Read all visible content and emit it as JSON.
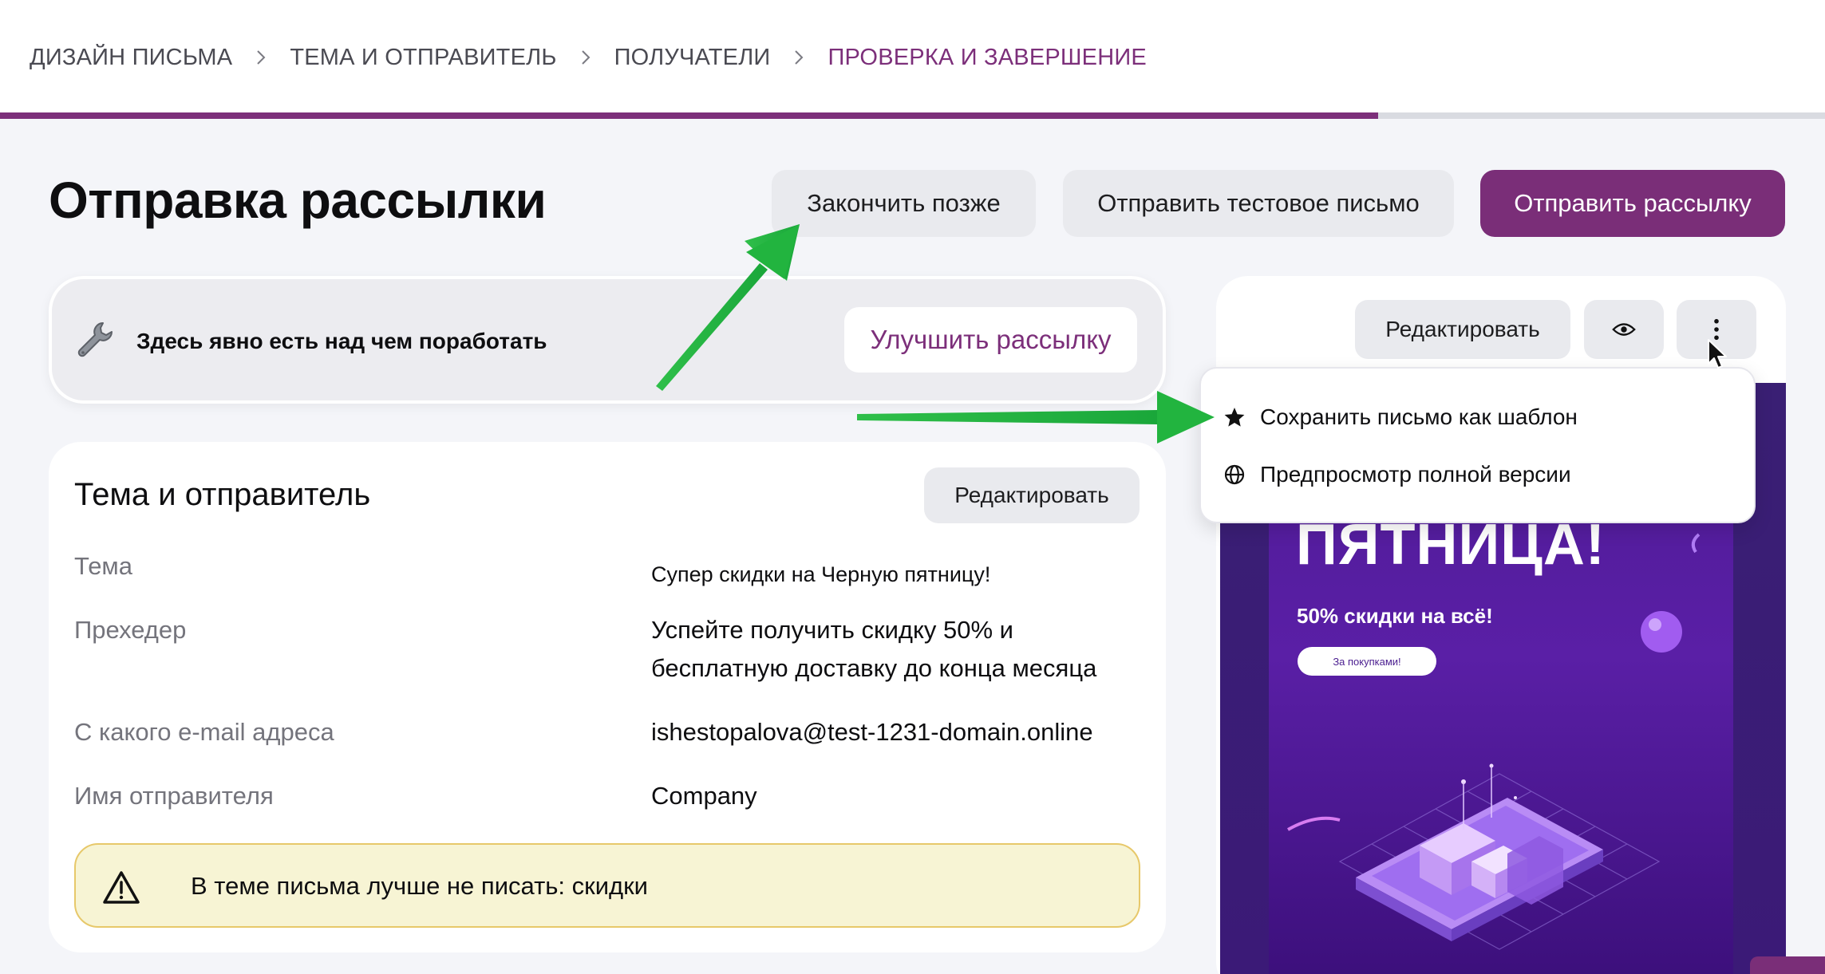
{
  "breadcrumbs": [
    {
      "label": "ДИЗАЙН ПИСЬМА",
      "active": false
    },
    {
      "label": "ТЕМА И ОТПРАВИТЕЛЬ",
      "active": false
    },
    {
      "label": "ПОЛУЧАТЕЛИ",
      "active": false
    },
    {
      "label": "ПРОВЕРКА И ЗАВЕРШЕНИЕ",
      "active": true
    }
  ],
  "progress": {
    "fraction": 0.755
  },
  "page": {
    "title": "Отправка рассылки"
  },
  "header_buttons": {
    "finish_later": "Закончить позже",
    "send_test": "Отправить тестовое письмо",
    "send_campaign": "Отправить рассылку"
  },
  "improve": {
    "icon": "wrench-icon",
    "text": "Здесь явно есть над чем поработать",
    "button": "Улучшить рассылку"
  },
  "subject_card": {
    "title": "Тема и отправитель",
    "edit_button": "Редактировать",
    "rows": [
      {
        "label": "Тема",
        "value": "Супер скидки на Черную пятницу!"
      },
      {
        "label": "Прехедер",
        "value": "Успейте получить скидку 50% и бесплатную доставку до конца месяца"
      },
      {
        "label": "С какого e-mail адреса",
        "value": "ishestopalova@test-1231-domain.online"
      },
      {
        "label": "Имя отправителя",
        "value": "Company"
      }
    ],
    "warning": "В теме письма лучше не писать: скидки"
  },
  "preview": {
    "edit_button": "Редактировать",
    "eye_icon": "eye-icon",
    "more_icon": "more-vertical-icon",
    "promo_title": "ПЯТНИЦА!",
    "promo_subtitle": "50% скидки на всё!",
    "promo_button": "За покупками!"
  },
  "menu": {
    "items": [
      {
        "icon": "star-icon",
        "label": "Сохранить письмо как шаблон"
      },
      {
        "icon": "globe-icon",
        "label": "Предпросмотр полной версии"
      }
    ]
  },
  "colors": {
    "brand": "#7a2e78",
    "arrow": "#22b43f",
    "warning_bg": "#f7f4d4",
    "warning_border": "#e7c86a"
  }
}
